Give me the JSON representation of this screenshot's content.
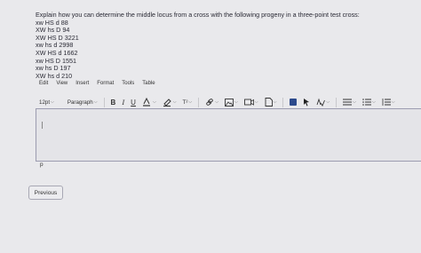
{
  "question": {
    "prompt": "Explain how you can determine the middle locus from a cross with the following progeny in a three-point test cross:",
    "progeny": [
      "xw   HS  d  88",
      "XW  hs  D  94",
      "XW  HS  D 3221",
      "xw  hs  d 2998",
      "XW  HS  d 1662",
      "xw  HS  D 1551",
      "xw  hs  D 197",
      "XW  hs  d 210"
    ]
  },
  "menubar": {
    "edit": "Edit",
    "view": "View",
    "insert": "Insert",
    "format": "Format",
    "tools": "Tools",
    "table": "Table"
  },
  "toolbar": {
    "font_size": "12pt",
    "paragraph": "Paragraph",
    "bold": "B",
    "italic": "I",
    "underline": "U",
    "superscript": "T²"
  },
  "editor": {
    "status_path": "p"
  },
  "navigation": {
    "previous_label": "Previous"
  }
}
